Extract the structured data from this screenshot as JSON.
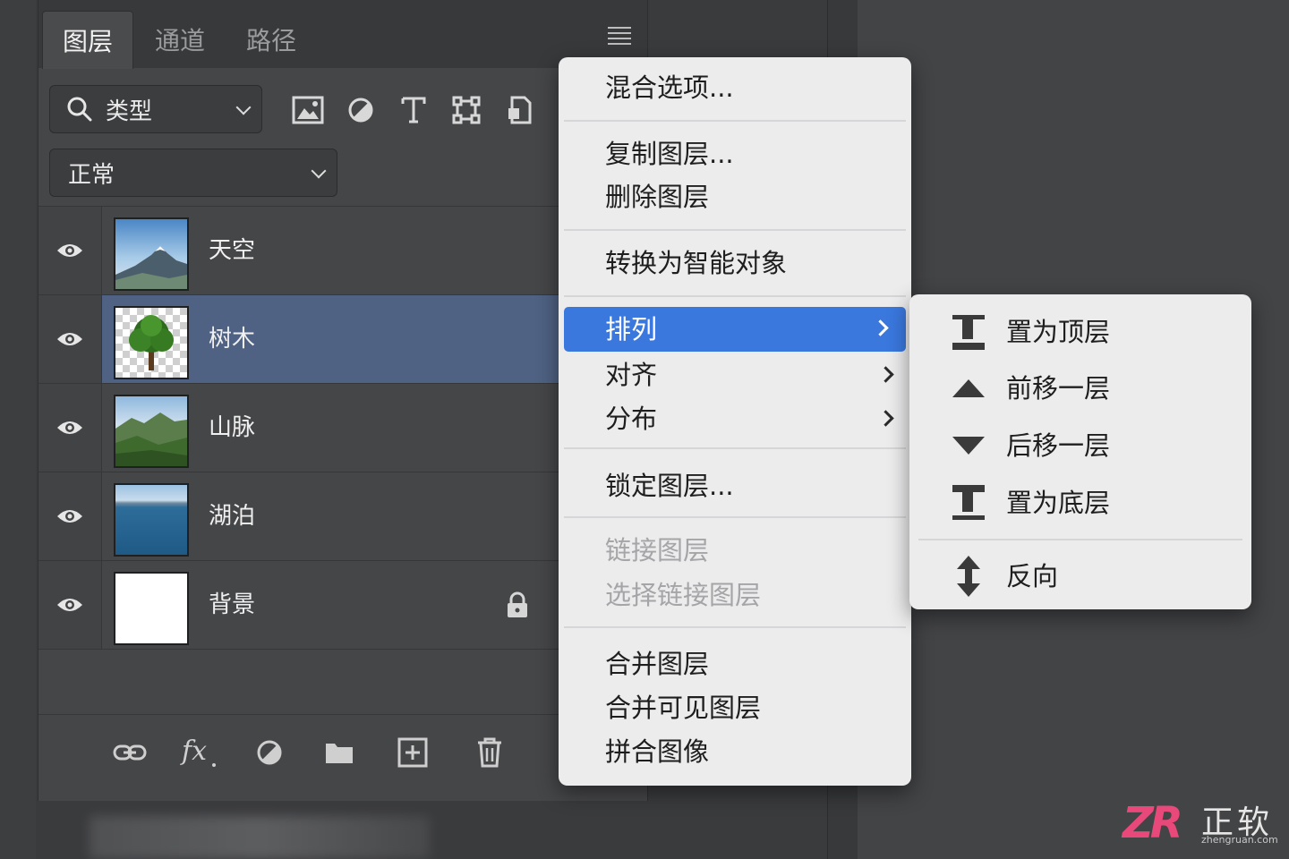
{
  "panel": {
    "tabs": [
      "图层",
      "通道",
      "路径"
    ],
    "active_tab": "图层",
    "filter": {
      "label": "类型",
      "icons": [
        "image-filter-icon",
        "adjustment-filter-icon",
        "type-filter-icon",
        "shape-filter-icon",
        "smart-object-filter-icon"
      ]
    },
    "blend_mode": "正常",
    "layers": [
      {
        "name": "天空",
        "thumb": "mountain-sky",
        "visible": true,
        "selected": false,
        "locked": false
      },
      {
        "name": "树木",
        "thumb": "tree",
        "visible": true,
        "selected": true,
        "locked": false
      },
      {
        "name": "山脉",
        "thumb": "green-mountains",
        "visible": true,
        "selected": false,
        "locked": false
      },
      {
        "name": "湖泊",
        "thumb": "lake",
        "visible": true,
        "selected": false,
        "locked": false
      },
      {
        "name": "背景",
        "thumb": "white",
        "visible": true,
        "selected": false,
        "locked": true
      }
    ],
    "footer_icons": [
      "link-icon",
      "fx-icon",
      "adjustment-icon",
      "folder-icon",
      "new-layer-icon",
      "trash-icon"
    ]
  },
  "context_menu": {
    "items": [
      {
        "label": "混合选项...",
        "disabled": false
      },
      {
        "label": "复制图层...",
        "disabled": false
      },
      {
        "label": "删除图层",
        "disabled": false
      },
      {
        "label": "转换为智能对象",
        "disabled": false
      },
      {
        "label": "排列",
        "disabled": false,
        "submenu": true,
        "active": true
      },
      {
        "label": "对齐",
        "disabled": false,
        "submenu": true
      },
      {
        "label": "分布",
        "disabled": false,
        "submenu": true
      },
      {
        "label": "锁定图层...",
        "disabled": false
      },
      {
        "label": "链接图层",
        "disabled": true
      },
      {
        "label": "选择链接图层",
        "disabled": true
      },
      {
        "label": "合并图层",
        "disabled": false
      },
      {
        "label": "合并可见图层",
        "disabled": false
      },
      {
        "label": "拼合图像",
        "disabled": false
      }
    ]
  },
  "submenu": {
    "items": [
      {
        "label": "置为顶层",
        "icon": "bring-to-front-icon"
      },
      {
        "label": "前移一层",
        "icon": "bring-forward-icon"
      },
      {
        "label": "后移一层",
        "icon": "send-backward-icon"
      },
      {
        "label": "置为底层",
        "icon": "send-to-back-icon"
      },
      {
        "label": "反向",
        "icon": "reverse-icon"
      }
    ]
  },
  "watermark": {
    "mark": "ZR",
    "name": "正软",
    "url": "zhengruan.com",
    "color": "#e8497a"
  },
  "colors": {
    "selected_row": "#4f6283",
    "menu_highlight": "#3a78de",
    "menu_bg": "#ececed"
  }
}
